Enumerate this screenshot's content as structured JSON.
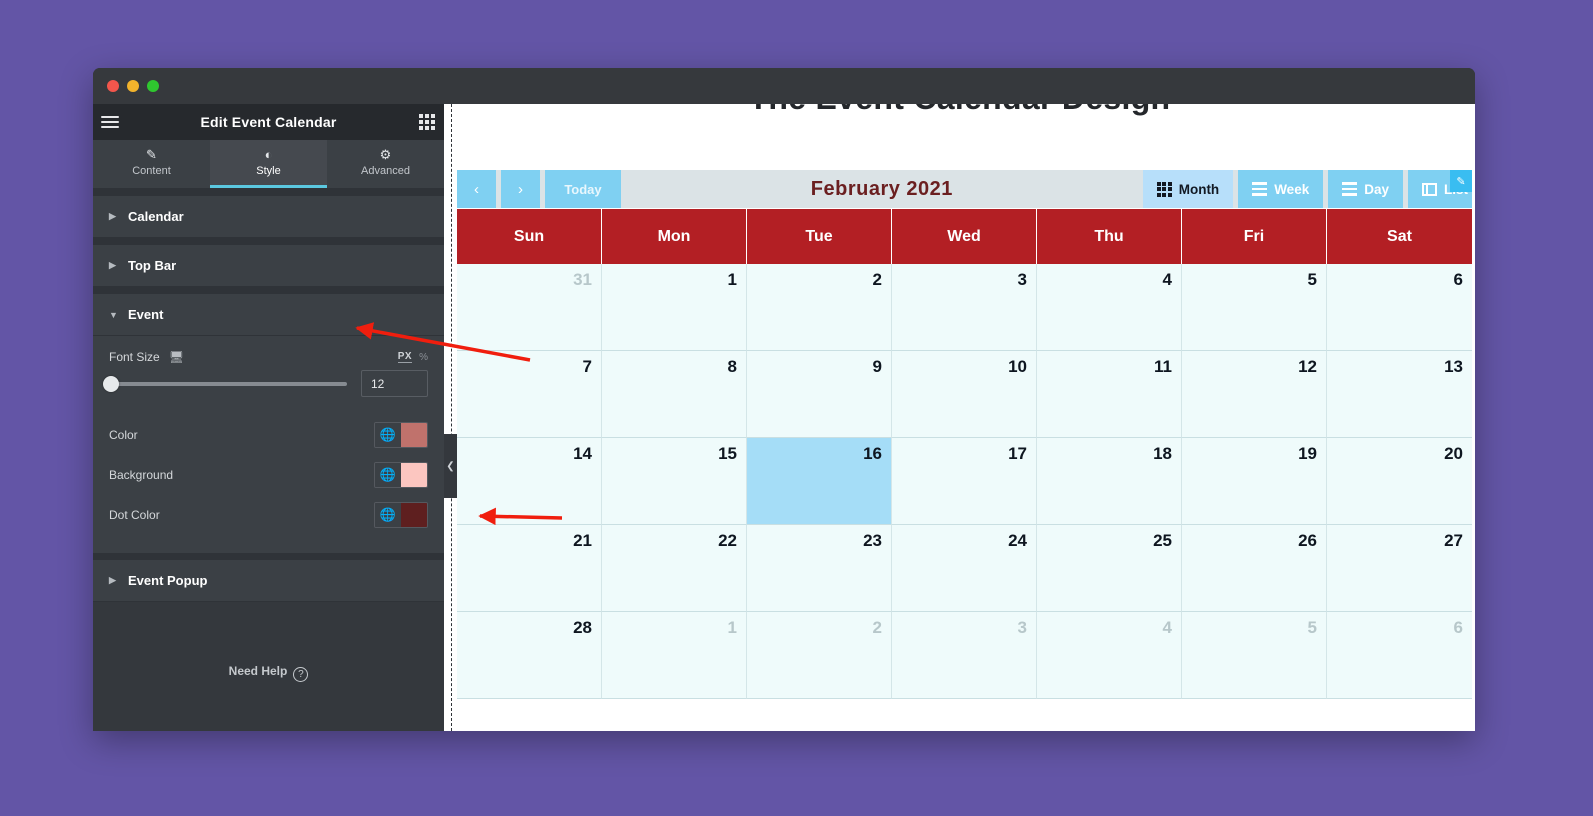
{
  "window": {
    "traffic_lights": [
      "close",
      "minimize",
      "maximize"
    ]
  },
  "panel": {
    "title": "Edit Event Calendar",
    "menu_icon": "hamburger-icon",
    "apps_icon": "grid-apps-icon",
    "tabs": [
      {
        "label": "Content",
        "icon": "pencil-icon",
        "glyph": "✎",
        "active": false
      },
      {
        "label": "Style",
        "icon": "half-circle-icon",
        "glyph": "◐",
        "active": true
      },
      {
        "label": "Advanced",
        "icon": "gear-icon",
        "glyph": "⚙",
        "active": false
      }
    ],
    "sections": [
      {
        "label": "Calendar",
        "expanded": false
      },
      {
        "label": "Top Bar",
        "expanded": false
      },
      {
        "label": "Event",
        "expanded": true
      },
      {
        "label": "Event Popup",
        "expanded": false
      }
    ],
    "event_controls": {
      "font_size_label": "Font Size",
      "responsive_icon": "desktop-monitor-icon",
      "unit_active": "PX",
      "unit_other": "%",
      "font_size_value": "12",
      "color_label": "Color",
      "color_value": "#c0726c",
      "background_label": "Background",
      "background_value": "#fcc6c0",
      "dot_color_label": "Dot Color",
      "dot_color_value": "#5e1f1f",
      "globe_icon": "globe-icon"
    },
    "need_help": "Need Help",
    "need_help_icon": "question-mark-icon"
  },
  "canvas": {
    "page_title": "The Event Calendar Design",
    "collapse_icon": "chevron-left-icon",
    "edit_badge_icon": "pencil-edit-icon"
  },
  "calendar": {
    "prev_label": "‹",
    "next_label": "›",
    "today_label": "Today",
    "month_title": "February 2021",
    "views": [
      {
        "label": "Month",
        "icon": "grid-month-icon",
        "active": true,
        "clipped": false
      },
      {
        "label": "Week",
        "icon": "list-week-icon",
        "active": false,
        "clipped": false
      },
      {
        "label": "Day",
        "icon": "lines-day-icon",
        "active": false,
        "clipped": false
      },
      {
        "label": "List",
        "icon": "table-list-icon",
        "active": false,
        "clipped": true
      }
    ],
    "weekdays": [
      "Sun",
      "Mon",
      "Tue",
      "Wed",
      "Thu",
      "Fri",
      "Sat"
    ],
    "days": [
      {
        "n": "31",
        "other": true,
        "selected": false
      },
      {
        "n": "1",
        "other": false,
        "selected": false
      },
      {
        "n": "2",
        "other": false,
        "selected": false
      },
      {
        "n": "3",
        "other": false,
        "selected": false
      },
      {
        "n": "4",
        "other": false,
        "selected": false
      },
      {
        "n": "5",
        "other": false,
        "selected": false
      },
      {
        "n": "6",
        "other": false,
        "selected": false
      },
      {
        "n": "7",
        "other": false,
        "selected": false
      },
      {
        "n": "8",
        "other": false,
        "selected": false
      },
      {
        "n": "9",
        "other": false,
        "selected": false
      },
      {
        "n": "10",
        "other": false,
        "selected": false
      },
      {
        "n": "11",
        "other": false,
        "selected": false
      },
      {
        "n": "12",
        "other": false,
        "selected": false
      },
      {
        "n": "13",
        "other": false,
        "selected": false
      },
      {
        "n": "14",
        "other": false,
        "selected": false
      },
      {
        "n": "15",
        "other": false,
        "selected": false
      },
      {
        "n": "16",
        "other": false,
        "selected": true
      },
      {
        "n": "17",
        "other": false,
        "selected": false
      },
      {
        "n": "18",
        "other": false,
        "selected": false
      },
      {
        "n": "19",
        "other": false,
        "selected": false
      },
      {
        "n": "20",
        "other": false,
        "selected": false
      },
      {
        "n": "21",
        "other": false,
        "selected": false
      },
      {
        "n": "22",
        "other": false,
        "selected": false
      },
      {
        "n": "23",
        "other": false,
        "selected": false
      },
      {
        "n": "24",
        "other": false,
        "selected": false
      },
      {
        "n": "25",
        "other": false,
        "selected": false
      },
      {
        "n": "26",
        "other": false,
        "selected": false
      },
      {
        "n": "27",
        "other": false,
        "selected": false
      },
      {
        "n": "28",
        "other": false,
        "selected": false
      },
      {
        "n": "1",
        "other": true,
        "selected": false
      },
      {
        "n": "2",
        "other": true,
        "selected": false
      },
      {
        "n": "3",
        "other": true,
        "selected": false
      },
      {
        "n": "4",
        "other": true,
        "selected": false
      },
      {
        "n": "5",
        "other": true,
        "selected": false
      },
      {
        "n": "6",
        "other": true,
        "selected": false
      }
    ]
  },
  "annotations": {
    "arrow_color": "#f01e0e",
    "arrows": [
      {
        "name": "arrow-to-event-section",
        "points_to": "Event section header"
      },
      {
        "name": "arrow-to-calendar-cell",
        "points_to": "calendar day cell area"
      }
    ]
  },
  "colors": {
    "desktop_bg": "#6355a6",
    "panel_bg": "#34383d",
    "panel_section_bg": "#3b4045",
    "accent_cyan": "#5bc8e0",
    "calendar_header_red": "#b31f24",
    "cell_bg": "#effbfb",
    "selected_cell": "#a5ddf7",
    "toolbar_bg": "#dbe3e6",
    "button_blue": "#7fd0f2",
    "active_view_blue": "#b7dffa",
    "month_title_color": "#6b1f20"
  }
}
